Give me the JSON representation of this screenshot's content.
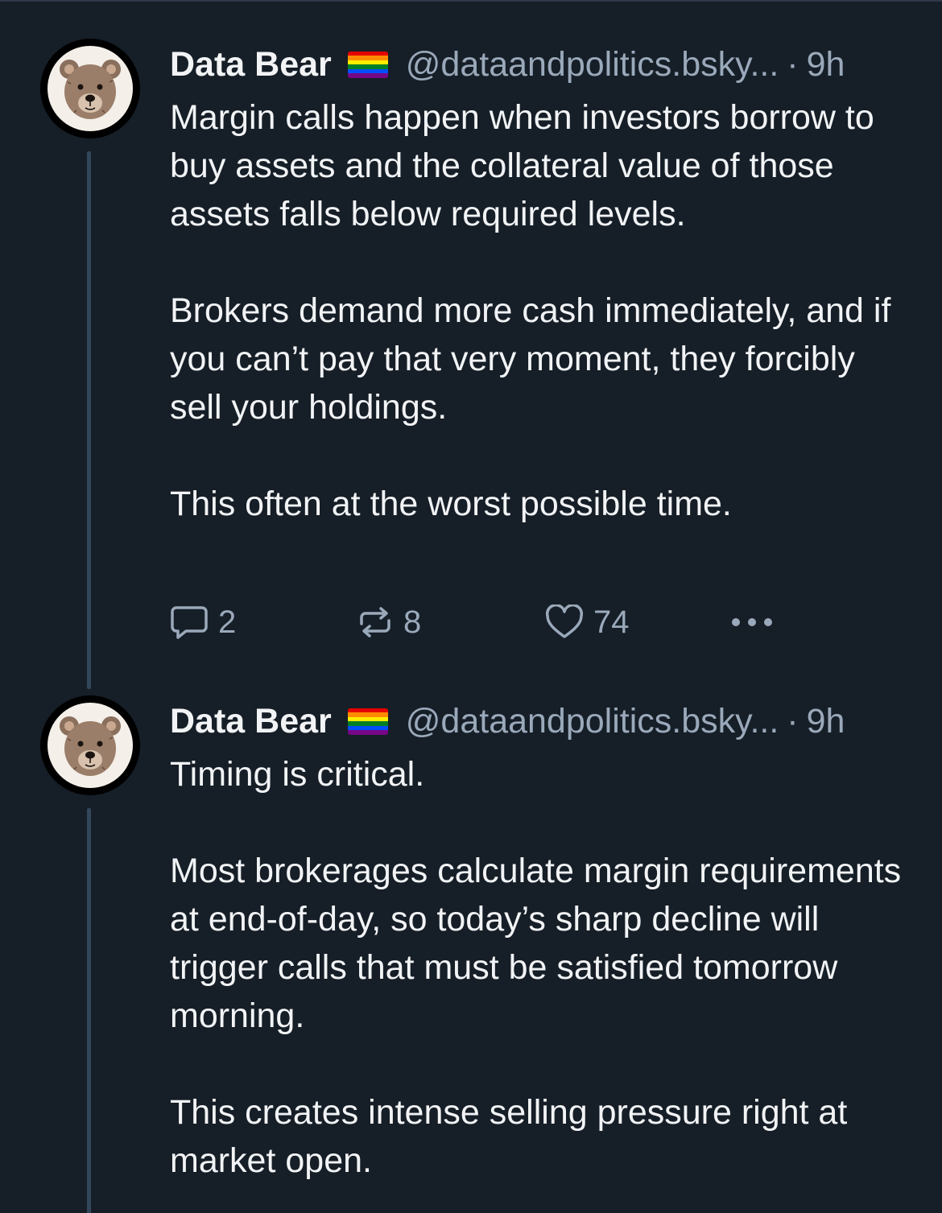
{
  "thread": {
    "posts": [
      {
        "author": {
          "display_name": "Data Bear",
          "handle": "@dataandpolitics.bsky...",
          "avatar_icon": "bear-avatar-icon",
          "flag_icon": "rainbow-flag-icon"
        },
        "separator": "·",
        "time": "9h",
        "paragraphs": [
          "Margin calls happen when investors borrow to buy assets and the collateral value of those assets falls below required levels.",
          "Brokers demand more cash immediately, and if you can’t pay that very moment, they forcibly sell your holdings.",
          "This often at the worst possible time."
        ],
        "stats": {
          "replies": "2",
          "reposts": "8",
          "likes": "74"
        }
      },
      {
        "author": {
          "display_name": "Data Bear",
          "handle": "@dataandpolitics.bsky...",
          "avatar_icon": "bear-avatar-icon",
          "flag_icon": "rainbow-flag-icon"
        },
        "separator": "·",
        "time": "9h",
        "paragraphs": [
          "Timing is critical.",
          "Most brokerages calculate margin requirements at end-of-day, so today’s sharp decline will trigger calls that must be satisfied tomorrow morning.",
          "This creates intense selling pressure right at market open."
        ]
      }
    ]
  },
  "colors": {
    "background": "#161e27",
    "text_primary": "#f1f3f5",
    "text_secondary": "#9aa9ba",
    "thread_line": "#33475b",
    "flag_stripes": [
      "#e40303",
      "#ff8c00",
      "#ffed00",
      "#008026",
      "#004dff",
      "#750787"
    ]
  }
}
